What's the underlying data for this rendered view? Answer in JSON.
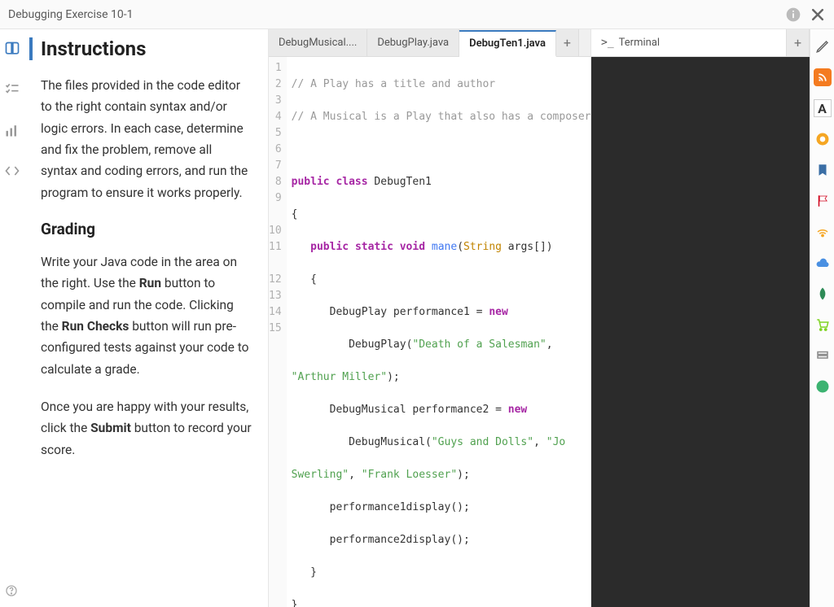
{
  "header": {
    "title": "Debugging Exercise 10-1"
  },
  "instructions": {
    "heading": "Instructions",
    "p1": "The files provided in the code editor to the right contain syntax and/or logic errors. In each case, determine and fix the problem, remove all syntax and coding errors, and run the program to ensure it works properly.",
    "h2": "Grading",
    "p2_pre": "Write your Java code in the area on the right. Use the ",
    "p2_b1": "Run",
    "p2_mid1": " button to compile and run the code. Clicking the ",
    "p2_b2": "Run Checks",
    "p2_mid2": " button will run pre-configured tests against your code to calculate a grade.",
    "p3_pre": "Once you are happy with your results, click the ",
    "p3_b1": "Submit",
    "p3_post": " button to record your score."
  },
  "tabs": {
    "t1": "DebugMusical....",
    "t2": "DebugPlay.java",
    "t3": "DebugTen1.java",
    "plus": "+"
  },
  "terminal": {
    "label": "Terminal",
    "plus": "+"
  },
  "code": {
    "l1": "// A Play has a title and author",
    "l2": "// A Musical is a Play that also has a composer",
    "l3": "",
    "l4_kw1": "public",
    "l4_kw2": "class",
    "l4_cls": "DebugTen1",
    "l5": "{",
    "l6_ind": "   ",
    "l6_kw1": "public",
    "l6_kw2": "static",
    "l6_kw3": "void",
    "l6_fn": "mane",
    "l6_sig_open": "(",
    "l6_ty": "String",
    "l6_arg": " args[])",
    "l7": "   {",
    "l8_ind": "      ",
    "l8_ty": "DebugPlay",
    "l8_var": " performance1 = ",
    "l8_kw": "new",
    "l9_ind": "         ",
    "l9_ty": "DebugPlay",
    "l9_paren": "(",
    "l9_s1": "\"Death of a Salesman\"",
    "l9_comma": ",",
    "l9b_s": "\"Arthur Miller\"",
    "l9b_paren": ");",
    "l10_ind": "      ",
    "l10_ty": "DebugMusical",
    "l10_var": " performance2 = ",
    "l10_kw": "new",
    "l11_ind": "         ",
    "l11_ty": "DebugMusical",
    "l11_paren": "(",
    "l11_s1": "\"Guys and Dolls\"",
    "l11_c": ", ",
    "l11_s2": "\"Jo",
    "l11b_s1": "Swerling\"",
    "l11b_c": ", ",
    "l11b_s2": "\"Frank Loesser\"",
    "l11b_paren": ");",
    "l12": "      performance1display();",
    "l13": "      performance2display();",
    "l14": "   }",
    "l15": "}"
  },
  "gutter": [
    "1",
    "2",
    "3",
    "4",
    "5",
    "6",
    "7",
    "8",
    "9",
    "",
    "10",
    "11",
    "",
    "12",
    "13",
    "14",
    "15"
  ]
}
